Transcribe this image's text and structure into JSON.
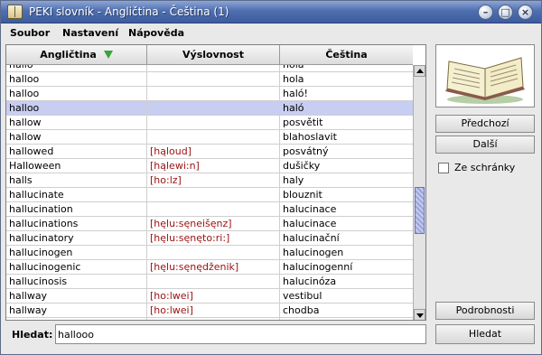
{
  "window": {
    "title": "PEKI slovník - Angličtina - Čeština  (1)",
    "controls": {
      "minimize": "–",
      "maximize": "□",
      "close": "×"
    }
  },
  "menu": [
    "Soubor",
    "Nastavení",
    "Nápověda"
  ],
  "table": {
    "columns": [
      "Angličtina",
      "Výslovnost",
      "Čeština"
    ],
    "sort_column": "Angličtina",
    "sort_icon_color": "#3aa33a",
    "rows": [
      {
        "en": "hallo",
        "pron": "",
        "cz": "hola"
      },
      {
        "en": "halloo",
        "pron": "",
        "cz": "hola"
      },
      {
        "en": "halloo",
        "pron": "",
        "cz": "haló!"
      },
      {
        "en": "halloo",
        "pron": "",
        "cz": "haló",
        "selected": true
      },
      {
        "en": "hallow",
        "pron": "",
        "cz": "posvětit"
      },
      {
        "en": "hallow",
        "pron": "",
        "cz": "blahoslavit"
      },
      {
        "en": "hallowed",
        "pron": "[hąloud]",
        "cz": "posvátný"
      },
      {
        "en": "Halloween",
        "pron": "[hąlewi:n]",
        "cz": "dušičky"
      },
      {
        "en": "halls",
        "pron": "[ho:lz]",
        "cz": "haly"
      },
      {
        "en": "hallucinate",
        "pron": "",
        "cz": "blouznit"
      },
      {
        "en": "hallucination",
        "pron": "",
        "cz": "halucinace"
      },
      {
        "en": "hallucinations",
        "pron": "[hęlu:sęneišęnz]",
        "cz": "halucinace"
      },
      {
        "en": "hallucinatory",
        "pron": "[hęlu:sęnęto:ri:]",
        "cz": "halucinační"
      },
      {
        "en": "hallucinogen",
        "pron": "",
        "cz": "halucinogen"
      },
      {
        "en": "hallucinogenic",
        "pron": "[hęlu:sęnędženik]",
        "cz": "halucinogenní"
      },
      {
        "en": "hallucinosis",
        "pron": "",
        "cz": "halucinóza"
      },
      {
        "en": "hallway",
        "pron": "[ho:lwei]",
        "cz": "vestibul"
      },
      {
        "en": "hallway",
        "pron": "[ho:lwei]",
        "cz": "chodba"
      },
      {
        "en": "hallway",
        "pron": "[ho:lwei]",
        "cz": "hala"
      }
    ],
    "selected_color": "#c8cdf2",
    "pronunciation_color": "#9b1010",
    "scroll_position": 0.55
  },
  "side": {
    "preview_icon": "open-book-icon",
    "prev_button": "Předchozí",
    "next_button": "Další",
    "from_phrases_label": "Ze schránky",
    "details_button": "Podrobnosti",
    "search_button": "Hledat"
  },
  "search": {
    "label": "Hledat:",
    "value": "hallooo"
  }
}
